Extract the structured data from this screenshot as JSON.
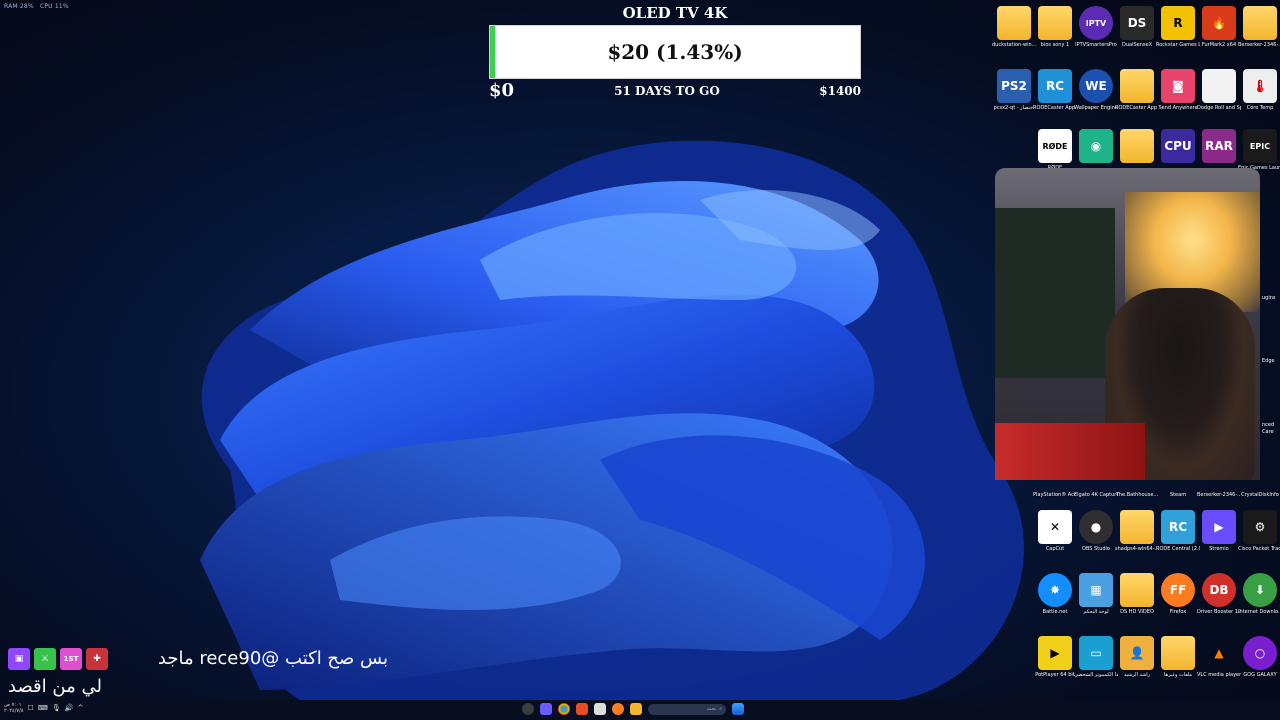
{
  "system_stats": {
    "ram": "RAM 28%",
    "cpu": "CPU 11%"
  },
  "goal": {
    "title": "OLED TV 4K",
    "amount_text": "$20 (1.43%)",
    "progress_fraction": 0.0143,
    "min_label": "$0",
    "max_label": "$1400",
    "days_label": "51 DAYS TO GO"
  },
  "desktop_icons": [
    {
      "label": "duckstation-win...",
      "icon": "folder-icon"
    },
    {
      "label": "bios sony 1",
      "icon": "folder-icon"
    },
    {
      "label": "IPTVSmartersPro",
      "icon": "iptv-icon"
    },
    {
      "label": "DualSenseX",
      "icon": "dualsense-icon"
    },
    {
      "label": "Rockstar Games Launcher",
      "icon": "rockstar-icon"
    },
    {
      "label": "FurMark2 x64",
      "icon": "furmark-icon"
    },
    {
      "label": "Berserker-2346-...",
      "icon": "folder-icon"
    },
    {
      "label": "pcsx2-qt - اختصار",
      "icon": "pcsx2-icon"
    },
    {
      "label": "RODECaster App (2.0.102)",
      "icon": "rode-app-icon"
    },
    {
      "label": "Wallpaper Engine",
      "icon": "wallpaper-engine-icon"
    },
    {
      "label": "RODECaster App Windows v2.0.105",
      "icon": "folder-icon"
    },
    {
      "label": "Send Anywhere",
      "icon": "send-anywhere-icon"
    },
    {
      "label": "Dodge Roll and Sprint-496-2-30...",
      "icon": "file-icon"
    },
    {
      "label": "Core Temp",
      "icon": "core-temp-icon"
    },
    {
      "label": "RØDE",
      "icon": "rode-icon"
    },
    {
      "label": "",
      "icon": "controller-app-icon"
    },
    {
      "label": "",
      "icon": "folder-icon"
    },
    {
      "label": "",
      "icon": "cpu-icon"
    },
    {
      "label": "",
      "icon": "winrar-icon"
    },
    {
      "label": "Epic Games Launcher",
      "icon": "epic-icon"
    },
    {
      "label": "PlayStation® Accessories",
      "icon": "playstation-icon"
    },
    {
      "label": "Elgato 4K Capture Utility",
      "icon": "elgato-icon"
    },
    {
      "label": "The.Bathhouse...",
      "icon": "folder-icon"
    },
    {
      "label": "Steam",
      "icon": "steam-icon"
    },
    {
      "label": "Berserker-2346-...",
      "icon": "folder-icon"
    },
    {
      "label": "CrystalDiskInfo",
      "icon": "crystaldisk-icon"
    },
    {
      "label": "CapCut",
      "icon": "capcut-icon"
    },
    {
      "label": "OBS Studio",
      "icon": "obs-icon"
    },
    {
      "label": "shadps4-win64-...",
      "icon": "folder-icon"
    },
    {
      "label": "RODE Central (2.0.65)",
      "icon": "rode-central-icon"
    },
    {
      "label": "Stremio",
      "icon": "stremio-icon"
    },
    {
      "label": "Cisco Packet Tracer",
      "icon": "cisco-icon"
    },
    {
      "label": "Battle.net",
      "icon": "battlenet-icon"
    },
    {
      "label": "لوحة التحكم",
      "icon": "control-panel-icon"
    },
    {
      "label": "DS HD VIDEO",
      "icon": "folder-icon"
    },
    {
      "label": "Firefox",
      "icon": "firefox-icon"
    },
    {
      "label": "Driver Booster 12",
      "icon": "driver-booster-icon"
    },
    {
      "label": "Internet Downlo...",
      "icon": "idm-icon"
    },
    {
      "label": "PotPlayer 64 bit",
      "icon": "potplayer-icon"
    },
    {
      "label": "هذا الكمبيوتر الشخصي",
      "icon": "this-pc-icon"
    },
    {
      "label": "راشد الرشيد",
      "icon": "user-folder-icon"
    },
    {
      "label": "ملفات وغيرها",
      "icon": "folder-icon"
    },
    {
      "label": "VLC media player",
      "icon": "vlc-icon"
    },
    {
      "label": "GOG GALAXY",
      "icon": "gog-icon"
    }
  ],
  "partial_labels": [
    "Edge",
    "ugins",
    "nced",
    "Care"
  ],
  "chat": {
    "line1": "بس صح اكتب @rece90 ماجد",
    "line2": "لي من اقصد",
    "badges": [
      "twitch-badge-icon",
      "sword-badge-icon",
      "first-badge-icon",
      "gift-badge-icon"
    ],
    "badge_text": "1ST"
  },
  "taskbar": {
    "clock_time": "٧:٠١ ص",
    "clock_date": "٢٠٢٤/٧/٨",
    "search_placeholder": "بحث"
  }
}
